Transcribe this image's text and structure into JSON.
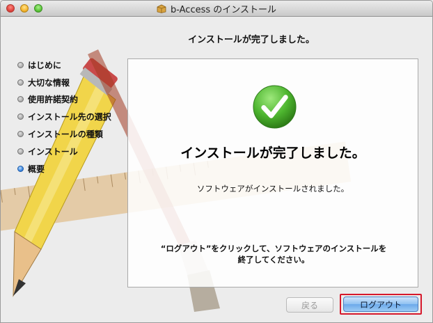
{
  "window": {
    "title": "b-Access のインストール",
    "heading": "インストールが完了しました。"
  },
  "steps": [
    {
      "label": "はじめに",
      "active": false
    },
    {
      "label": "大切な情報",
      "active": false
    },
    {
      "label": "使用許諾契約",
      "active": false
    },
    {
      "label": "インストール先の選択",
      "active": false
    },
    {
      "label": "インストールの種類",
      "active": false
    },
    {
      "label": "インストール",
      "active": false
    },
    {
      "label": "概要",
      "active": true
    }
  ],
  "panel": {
    "icon": "checkmark-success-icon",
    "title": "インストールが完了しました。",
    "subtitle": "ソフトウェアがインストールされました。",
    "note_line1": "“ログアウト”をクリックして、ソフトウェアのインストールを",
    "note_line2": "終了してください。"
  },
  "buttons": {
    "back_label": "戻る",
    "logout_label": "ログアウト"
  },
  "colors": {
    "accent_blue": "#6ba9ea",
    "highlight_red": "#d6182b",
    "success_green": "#4db52f"
  }
}
